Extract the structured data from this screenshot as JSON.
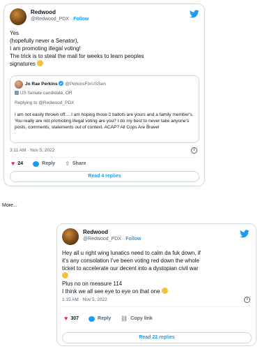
{
  "tweet1": {
    "name": "Redwood",
    "handle": "@Redwood_PDX",
    "follow": "Follow",
    "lines": [
      "Yes",
      "(hopefully never a Senator),",
      "I am promoting illegal voting!",
      "The trick is to steal the mail for weeks to learn peoples",
      "signatures"
    ],
    "quote": {
      "name": "Jo Rae Perkins",
      "handle": "@PerkinsForUSSen",
      "affiliation": "US Senate candidate, OR",
      "replying_to": "Replying to @Redwood_PDX",
      "text": "I am not easily thrown off.... I am hoping those 2 ballots are yours and a family member's. You really are not promoting illegal voting are you? I do my best to never take anyone's posts, comments, statements out of context. ACAP? All Cops Are Brave!"
    },
    "timestamp": "3:11 AM · Nov 5, 2022",
    "likes": "24",
    "reply_label": "Reply",
    "share_label": "Share",
    "replies_button": "Read 4 replies"
  },
  "more_label": "More...",
  "tweet2": {
    "name": "Redwood",
    "handle": "@Redwood_PDX",
    "follow": "Follow",
    "lines": [
      "Hey all u right wing lunatics need to calm da fuk down, if",
      "it's any consolation I've been voting red down the whole",
      "ticket to accelerate our decent into a dystopian civil war",
      "",
      "Plus no on measure 114",
      "I think we all see eye to eye on that one"
    ],
    "timestamp": "1:15 AM · Nov 5, 2022",
    "likes": "307",
    "reply_label": "Reply",
    "copy_label": "Copy link",
    "replies_button": "Read 22 replies"
  },
  "colors": {
    "accent": "#1d9bf0",
    "like": "#f91880",
    "muted": "#536471",
    "border": "#cfd9de"
  },
  "icons": [
    "twitter-bird-icon",
    "verified-badge-icon",
    "government-badge-icon",
    "heart-icon",
    "reply-icon",
    "share-icon",
    "link-icon",
    "info-icon",
    "grinning-emoji",
    "smiling-emoji"
  ]
}
